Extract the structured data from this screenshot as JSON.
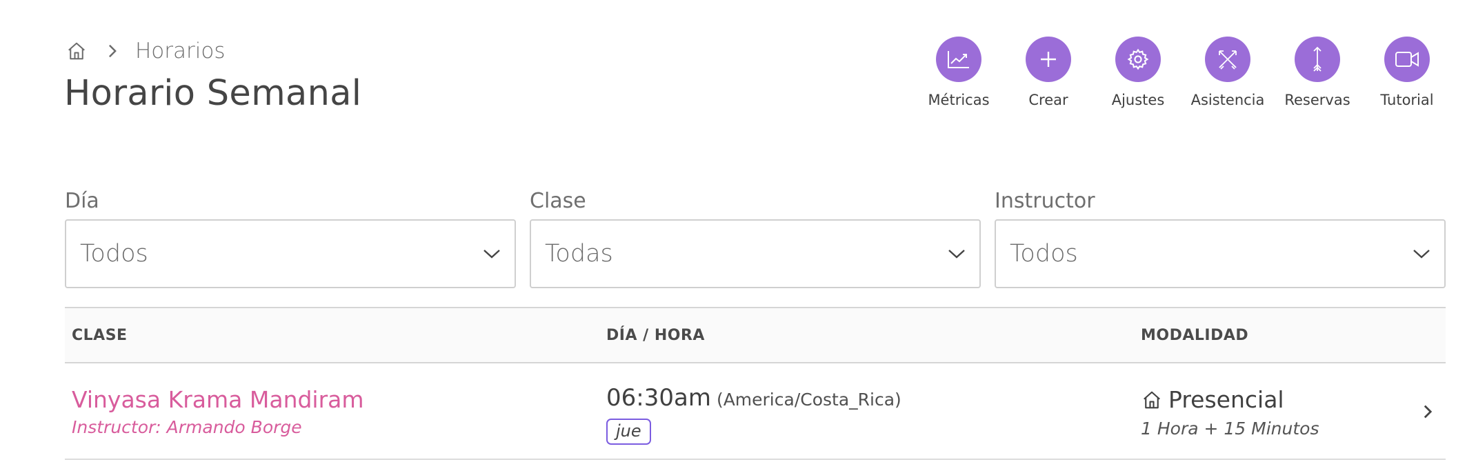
{
  "breadcrumb": {
    "home_icon": "home-icon",
    "separator_icon": "chevron-right-icon",
    "current": "Horarios"
  },
  "page": {
    "title": "Horario Semanal"
  },
  "actions": [
    {
      "label": "Métricas",
      "icon": "chart-line-icon"
    },
    {
      "label": "Crear",
      "icon": "plus-icon"
    },
    {
      "label": "Ajustes",
      "icon": "gear-icon"
    },
    {
      "label": "Asistencia",
      "icon": "crossed-arrows-icon"
    },
    {
      "label": "Reservas",
      "icon": "arrow-up-icon"
    },
    {
      "label": "Tutorial",
      "icon": "video-camera-icon"
    }
  ],
  "filters": {
    "day": {
      "label": "Día",
      "value": "Todos"
    },
    "class": {
      "label": "Clase",
      "value": "Todas"
    },
    "instructor": {
      "label": "Instructor",
      "value": "Todos"
    }
  },
  "table": {
    "headers": {
      "class": "CLASE",
      "day_time": "DÍA / HORA",
      "modality": "MODALIDAD"
    },
    "rows": [
      {
        "class_name": "Vinyasa Krama Mandiram",
        "instructor": "Instructor: Armando Borge",
        "time": "06:30am",
        "timezone": "(America/Costa_Rica)",
        "day": "jue",
        "modality": "Presencial",
        "modality_icon": "home-icon",
        "duration": "1 Hora + 15 Minutos"
      }
    ]
  },
  "colors": {
    "accent": "#9b6dd8",
    "class_link": "#d85c9c",
    "day_badge_border": "#7b5ce0"
  }
}
